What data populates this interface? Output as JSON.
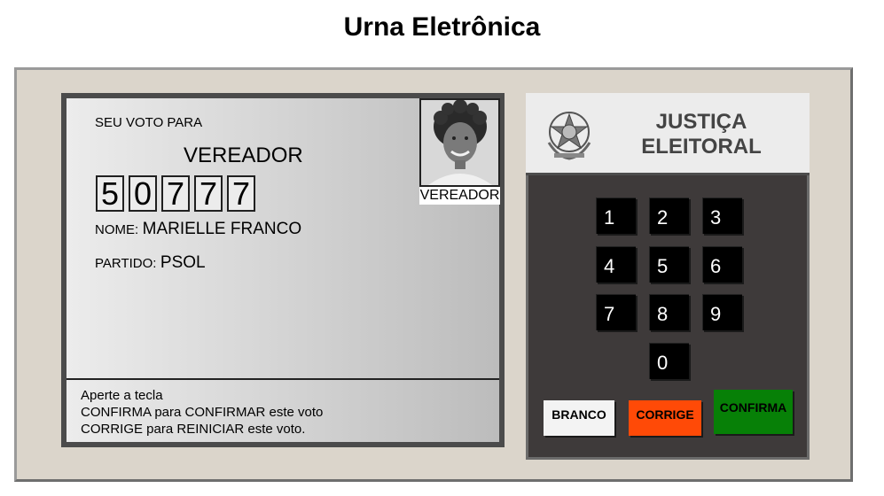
{
  "page": {
    "title": "Urna Eletrônica"
  },
  "screen": {
    "vote_label": "SEU VOTO PARA",
    "office": "VEREADOR",
    "digits": [
      "5",
      "0",
      "7",
      "7",
      "7"
    ],
    "name_label": "NOME:",
    "name_value": "MARIELLE FRANCO",
    "party_label": "PARTIDO:",
    "party_value": "PSOL",
    "photo_caption": "VEREADOR",
    "instructions": [
      "Aperte a tecla",
      "CONFIRMA para CONFIRMAR este voto",
      "CORRIGE para REINICIAR este voto."
    ]
  },
  "brand": {
    "line1": "JUSTIÇA",
    "line2": "ELEITORAL",
    "emblem": "coat-of-arms-icon"
  },
  "keypad": {
    "keys": [
      "1",
      "2",
      "3",
      "4",
      "5",
      "6",
      "7",
      "8",
      "9",
      "0"
    ],
    "branco": "BRANCO",
    "corrige": "CORRIGE",
    "confirma": "CONFIRMA"
  },
  "colors": {
    "machine_body": "#dbd5cb",
    "keypad_bg": "#3e3a3a",
    "branco": "#f3f3f3",
    "corrige": "#ff4a07",
    "confirma": "#078007"
  }
}
